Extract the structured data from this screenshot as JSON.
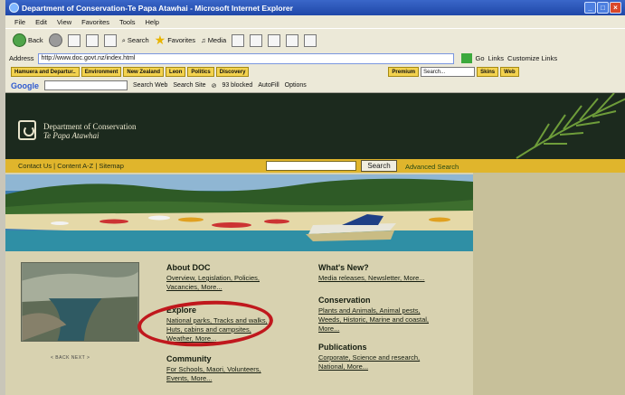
{
  "window": {
    "title": "Department of Conservation-Te Papa Atawhai - Microsoft Internet Explorer"
  },
  "menu": [
    "File",
    "Edit",
    "View",
    "Favorites",
    "Tools",
    "Help"
  ],
  "toolbar": {
    "back": "Back",
    "search": "Search",
    "favorites": "Favorites",
    "media": "Media"
  },
  "address": {
    "label": "Address",
    "url": "http://www.doc.govt.nz/index.html",
    "go": "Go",
    "links": "Links",
    "customize": "Customize Links"
  },
  "linksbar": {
    "items": [
      "Hamuera and Departur..",
      "Environment",
      "New Zealand",
      "Leon",
      "Politics",
      "Discovery"
    ],
    "premium": "Premium",
    "search_placeholder": "Search...",
    "skins": "Skins",
    "web": "Web"
  },
  "google": {
    "logo": "Google",
    "search_web": "Search Web",
    "search_site": "Search Site",
    "blocked": "93 blocked",
    "autofill": "AutoFill",
    "options": "Options"
  },
  "site": {
    "name": "Department of Conservation",
    "subname": "Te Papa Atawhai",
    "util_links": "Contact Us | Content A-Z | Sitemap",
    "search_button": "Search",
    "advanced_search": "Advanced Search"
  },
  "photo_nav": "< BACK   NEXT >",
  "sections": {
    "about": {
      "title": "About DOC",
      "lines": [
        "Overview, Legislation, Policies,",
        "Vacancies, More..."
      ]
    },
    "explore": {
      "title": "Explore",
      "lines": [
        "National parks, Tracks and walks,",
        "Huts, cabins and campsites,",
        "Weather, More..."
      ]
    },
    "community": {
      "title": "Community",
      "lines": [
        "For Schools, Maori, Volunteers,",
        "Events, More..."
      ]
    },
    "news": {
      "title": "What's New?",
      "lines": [
        "Media releases, Newsletter, More..."
      ]
    },
    "conservation": {
      "title": "Conservation",
      "lines": [
        "Plants and Animals, Animal pests,",
        "Weeds, Historic, Marine and coastal,",
        "More..."
      ]
    },
    "publications": {
      "title": "Publications",
      "lines": [
        "Corporate, Science and research,",
        "National, More..."
      ]
    }
  },
  "colors": {
    "header": "#1c2a1e",
    "util_bar": "#e0b52c",
    "page_bg": "#d8d2b0",
    "annotation": "#c0181d"
  }
}
